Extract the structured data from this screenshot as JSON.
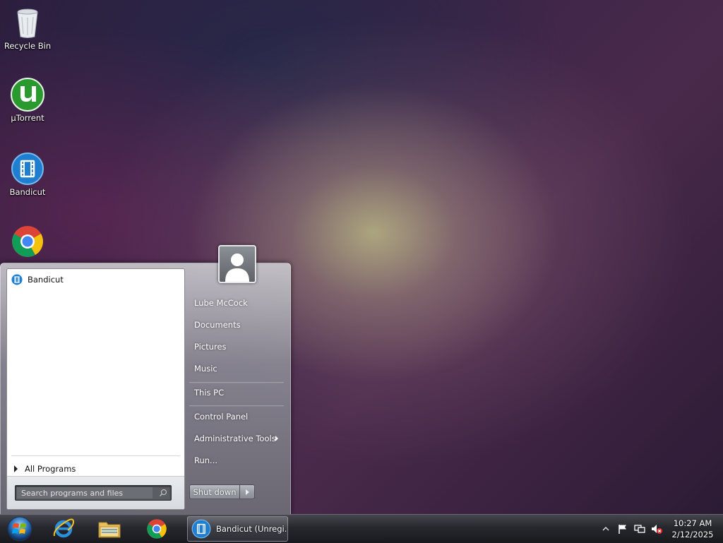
{
  "desktop": {
    "icons": [
      {
        "label": "Recycle Bin",
        "icon": "recycle-bin-icon"
      },
      {
        "label": "µTorrent",
        "icon": "utorrent-icon"
      },
      {
        "label": "Bandicut",
        "icon": "bandicut-icon"
      },
      {
        "label": "",
        "icon": "chrome-icon"
      }
    ]
  },
  "start_menu": {
    "pinned": [
      {
        "label": "Bandicut",
        "icon": "bandicut-icon"
      }
    ],
    "all_programs": "All Programs",
    "search_placeholder": "Search programs and files",
    "user_name": "Lube McCock",
    "right_items": {
      "documents": "Documents",
      "pictures": "Pictures",
      "music": "Music",
      "this_pc": "This PC",
      "control_panel": "Control Panel",
      "admin_tools": "Administrative Tools",
      "run": "Run..."
    },
    "shutdown_label": "Shut down"
  },
  "taskbar": {
    "pinned": [
      "internet-explorer-icon",
      "file-explorer-icon",
      "chrome-icon"
    ],
    "running_task": "Bandicut (Unregi...",
    "clock": {
      "time": "10:27 AM",
      "date": "2/12/2025"
    },
    "tray": [
      "show-hidden-icons-icon",
      "action-center-flag-icon",
      "network-icon",
      "volume-muted-icon"
    ]
  },
  "colors": {
    "accent": "#1e7fd0",
    "utorrent_green": "#2a9a2e"
  }
}
